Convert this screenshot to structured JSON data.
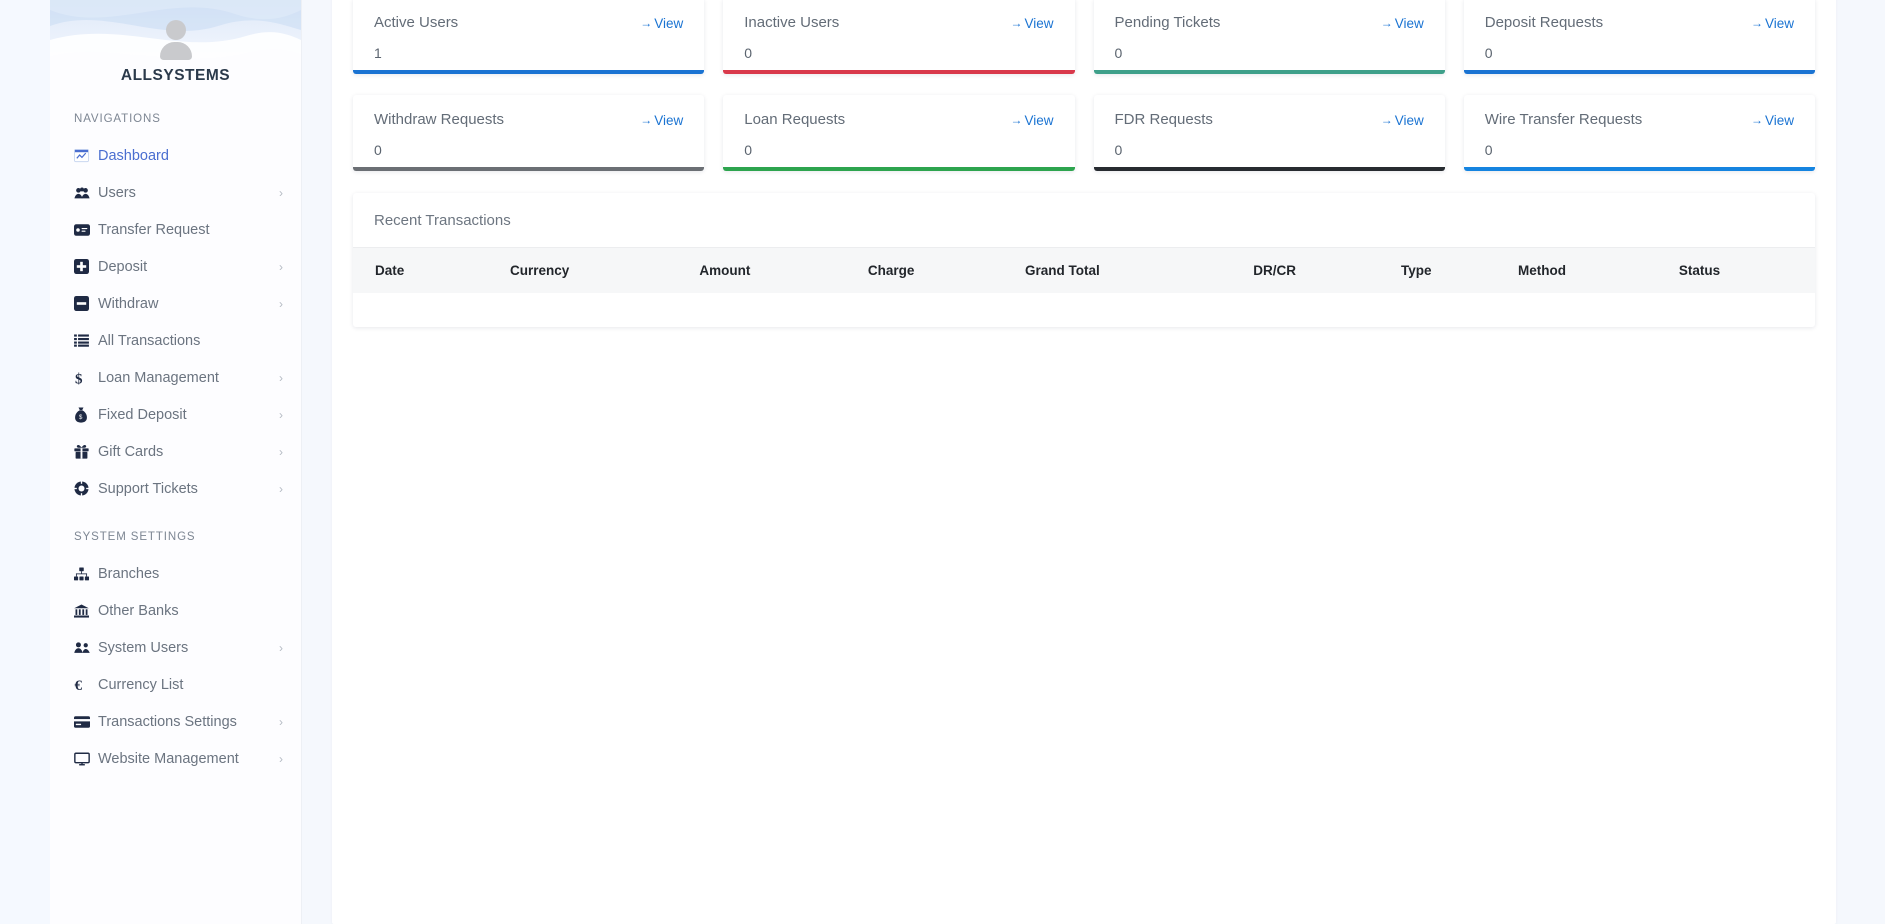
{
  "brand": {
    "name": "ALLSYSTEMS",
    "avatar_icon": "user-avatar-icon"
  },
  "sidebar": {
    "sections": [
      {
        "label": "NAVIGATIONS",
        "items": [
          {
            "label": "Dashboard",
            "icon": "dashboard-icon",
            "caret": "",
            "active": true
          },
          {
            "label": "Users",
            "icon": "users-icon",
            "caret": "›",
            "active": false
          },
          {
            "label": "Transfer Request",
            "icon": "transfer-card-icon",
            "caret": "",
            "active": false
          },
          {
            "label": "Deposit",
            "icon": "plus-square-icon",
            "caret": "›",
            "active": false
          },
          {
            "label": "Withdraw",
            "icon": "minus-square-icon",
            "caret": "›",
            "active": false
          },
          {
            "label": "All Transactions",
            "icon": "list-icon",
            "caret": "",
            "active": false
          },
          {
            "label": "Loan Management",
            "icon": "dollar-sign-icon",
            "caret": "›",
            "active": false
          },
          {
            "label": "Fixed Deposit",
            "icon": "money-bag-icon",
            "caret": "›",
            "active": false
          },
          {
            "label": "Gift Cards",
            "icon": "gift-icon",
            "caret": "›",
            "active": false
          },
          {
            "label": "Support Tickets",
            "icon": "life-ring-icon",
            "caret": "›",
            "active": false
          }
        ]
      },
      {
        "label": "SYSTEM SETTINGS",
        "items": [
          {
            "label": "Branches",
            "icon": "sitemap-icon",
            "caret": "",
            "active": false
          },
          {
            "label": "Other Banks",
            "icon": "bank-icon",
            "caret": "",
            "active": false
          },
          {
            "label": "System Users",
            "icon": "user-group-icon",
            "caret": "›",
            "active": false
          },
          {
            "label": "Currency List",
            "icon": "euro-icon",
            "caret": "",
            "active": false
          },
          {
            "label": "Transactions Settings",
            "icon": "credit-card-icon",
            "caret": "›",
            "active": false
          },
          {
            "label": "Website Management",
            "icon": "desktop-icon",
            "caret": "›",
            "active": false
          }
        ]
      }
    ]
  },
  "stats": {
    "view_label": "View",
    "view_arrow": "→",
    "row1": [
      {
        "title": "Active Users",
        "value": "1",
        "accent": "#1a73d2"
      },
      {
        "title": "Inactive Users",
        "value": "0",
        "accent": "#d9394b"
      },
      {
        "title": "Pending Tickets",
        "value": "0",
        "accent": "#3fa08a"
      },
      {
        "title": "Deposit Requests",
        "value": "0",
        "accent": "#1a73d2"
      }
    ],
    "row2": [
      {
        "title": "Withdraw Requests",
        "value": "0",
        "accent": "#6b6f74"
      },
      {
        "title": "Loan Requests",
        "value": "0",
        "accent": "#2da44e"
      },
      {
        "title": "FDR Requests",
        "value": "0",
        "accent": "#272b30"
      },
      {
        "title": "Wire Transfer Requests",
        "value": "0",
        "accent": "#1584e0"
      }
    ]
  },
  "transactions": {
    "title": "Recent Transactions",
    "columns": [
      "Date",
      "Currency",
      "Amount",
      "Charge",
      "Grand Total",
      "DR/CR",
      "Type",
      "Method",
      "Status"
    ],
    "rows": []
  }
}
